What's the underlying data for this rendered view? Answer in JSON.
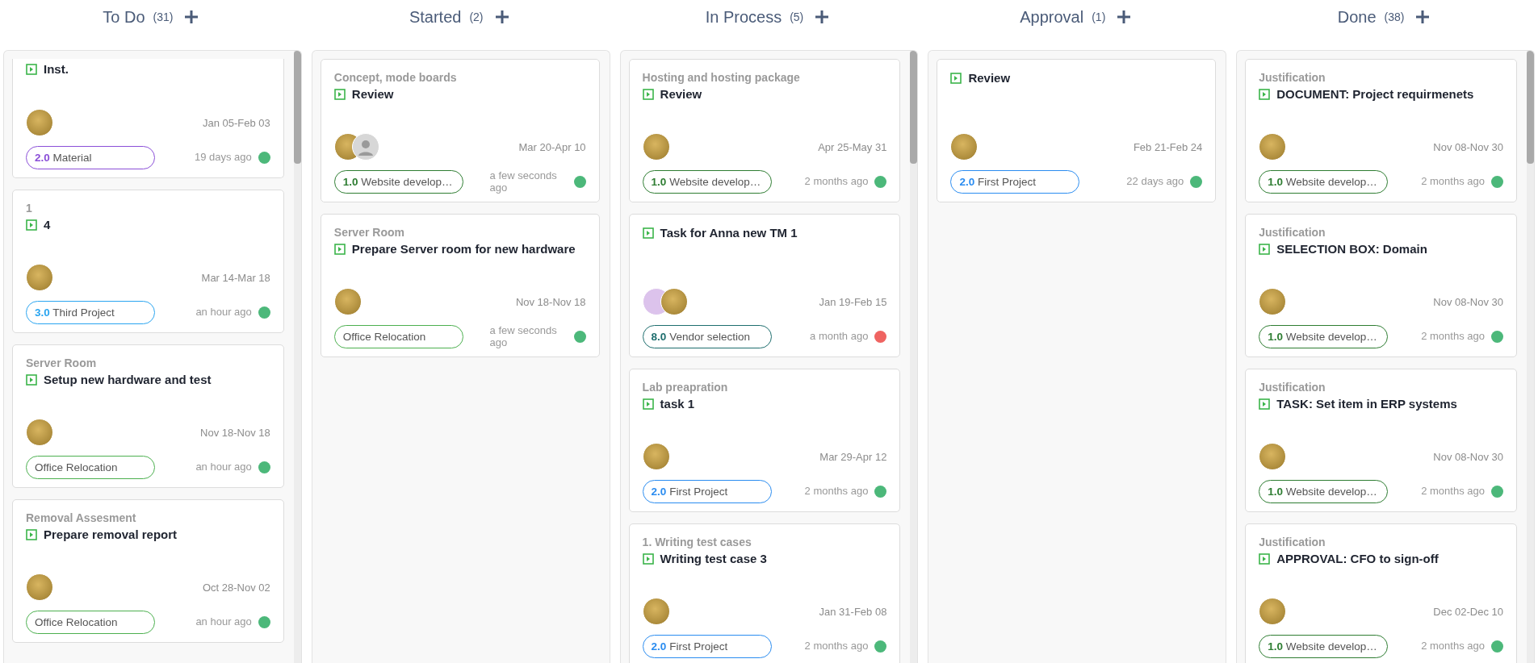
{
  "columns": [
    {
      "title": "To Do",
      "count": "(31)",
      "scrollable": true,
      "cards": [
        {
          "title": "Inst.",
          "avatars": [
            {
              "kind": "image"
            }
          ],
          "dates": "Jan 05-Feb 03",
          "tag": {
            "number": "2.0",
            "name": "Material",
            "color": "#8b4fd8"
          },
          "time": "19 days ago",
          "status": {
            "color": "#4cb87a"
          }
        },
        {
          "project": "1",
          "title": "4",
          "avatars": [
            {
              "kind": "image"
            }
          ],
          "dates": "Mar 14-Mar 18",
          "tag": {
            "number": "3.0",
            "name": "Third Project",
            "color": "#2aa5f0"
          },
          "time": "an hour ago",
          "status": {
            "color": "#4cb87a"
          }
        },
        {
          "project": "Server Room",
          "title": "Setup new hardware and test",
          "avatars": [
            {
              "kind": "image"
            }
          ],
          "dates": "Nov 18-Nov 18",
          "tag": {
            "name": "Office Relocation",
            "color": "#4cb04f"
          },
          "time": "an hour ago",
          "status": {
            "color": "#4cb87a"
          }
        },
        {
          "project": "Removal Assesment",
          "title": "Prepare removal report",
          "avatars": [
            {
              "kind": "image"
            }
          ],
          "dates": "Oct 28-Nov 02",
          "tag": {
            "name": "Office Relocation",
            "color": "#4cb04f"
          },
          "time": "an hour ago",
          "status": {
            "color": "#4cb87a"
          }
        }
      ]
    },
    {
      "title": "Started",
      "count": "(2)",
      "scrollable": false,
      "cards": [
        {
          "project": "Concept, mode boards",
          "title": "Review",
          "avatars": [
            {
              "kind": "image"
            },
            {
              "kind": "person"
            }
          ],
          "dates": "Mar 20-Apr 10",
          "tag": {
            "number": "1.0",
            "name": "Website develop…",
            "color": "#2e7d32"
          },
          "time": "a few seconds ago",
          "status": {
            "color": "#4cb87a"
          }
        },
        {
          "project": "Server Room",
          "title": "Prepare Server room for new hardware",
          "avatars": [
            {
              "kind": "image"
            }
          ],
          "dates": "Nov 18-Nov 18",
          "tag": {
            "name": "Office Relocation",
            "color": "#4cb04f"
          },
          "time": "a few seconds ago",
          "status": {
            "color": "#4cb87a"
          }
        }
      ]
    },
    {
      "title": "In Process",
      "count": "(5)",
      "scrollable": true,
      "cards": [
        {
          "project": "Hosting and hosting package",
          "title": "Review",
          "avatars": [
            {
              "kind": "image"
            }
          ],
          "dates": "Apr 25-May 31",
          "tag": {
            "number": "1.0",
            "name": "Website develop…",
            "color": "#2e7d32"
          },
          "time": "2 months ago",
          "status": {
            "color": "#4cb87a"
          }
        },
        {
          "title": "Task for Anna new TM 1",
          "avatars": [
            {
              "kind": "blank"
            },
            {
              "kind": "image"
            }
          ],
          "dates": "Jan 19-Feb 15",
          "tag": {
            "number": "8.0",
            "name": "Vendor selection",
            "color": "#1e6e6e"
          },
          "time": "a month ago",
          "status": {
            "color": "#ef6461"
          }
        },
        {
          "project": "Lab preapration",
          "title": "task 1",
          "avatars": [
            {
              "kind": "image"
            }
          ],
          "dates": "Mar 29-Apr 12",
          "tag": {
            "number": "2.0",
            "name": "First Project",
            "color": "#2a8cf0"
          },
          "time": "2 months ago",
          "status": {
            "color": "#4cb87a"
          }
        },
        {
          "project": "1. Writing test cases",
          "title": "Writing test case 3",
          "avatars": [
            {
              "kind": "image"
            }
          ],
          "dates": "Jan 31-Feb 08",
          "tag": {
            "number": "2.0",
            "name": "First Project",
            "color": "#2a8cf0"
          },
          "time": "2 months ago",
          "status": {
            "color": "#4cb87a"
          }
        }
      ]
    },
    {
      "title": "Approval",
      "count": "(1)",
      "scrollable": false,
      "cards": [
        {
          "title": "Review",
          "avatars": [
            {
              "kind": "image"
            }
          ],
          "dates": "Feb 21-Feb 24",
          "tag": {
            "number": "2.0",
            "name": "First Project",
            "color": "#2a8cf0"
          },
          "time": "22 days ago",
          "status": {
            "color": "#4cb87a"
          }
        }
      ]
    },
    {
      "title": "Done",
      "count": "(38)",
      "scrollable": true,
      "cards": [
        {
          "project": "Justification",
          "title": "DOCUMENT: Project requirmenets",
          "avatars": [
            {
              "kind": "image"
            }
          ],
          "dates": "Nov 08-Nov 30",
          "tag": {
            "number": "1.0",
            "name": "Website develop…",
            "color": "#2e7d32"
          },
          "time": "2 months ago",
          "status": {
            "color": "#4cb87a"
          }
        },
        {
          "project": "Justification",
          "title": "SELECTION BOX: Domain",
          "avatars": [
            {
              "kind": "image"
            }
          ],
          "dates": "Nov 08-Nov 30",
          "tag": {
            "number": "1.0",
            "name": "Website develop…",
            "color": "#2e7d32"
          },
          "time": "2 months ago",
          "status": {
            "color": "#4cb87a"
          }
        },
        {
          "project": "Justification",
          "title": "TASK: Set item in ERP systems",
          "avatars": [
            {
              "kind": "image"
            }
          ],
          "dates": "Nov 08-Nov 30",
          "tag": {
            "number": "1.0",
            "name": "Website develop…",
            "color": "#2e7d32"
          },
          "time": "2 months ago",
          "status": {
            "color": "#4cb87a"
          }
        },
        {
          "project": "Justification",
          "title": "APPROVAL: CFO to sign-off",
          "avatars": [
            {
              "kind": "image"
            }
          ],
          "dates": "Dec 02-Dec 10",
          "tag": {
            "number": "1.0",
            "name": "Website develop…",
            "color": "#2e7d32"
          },
          "time": "2 months ago",
          "status": {
            "color": "#4cb87a"
          }
        }
      ]
    }
  ]
}
